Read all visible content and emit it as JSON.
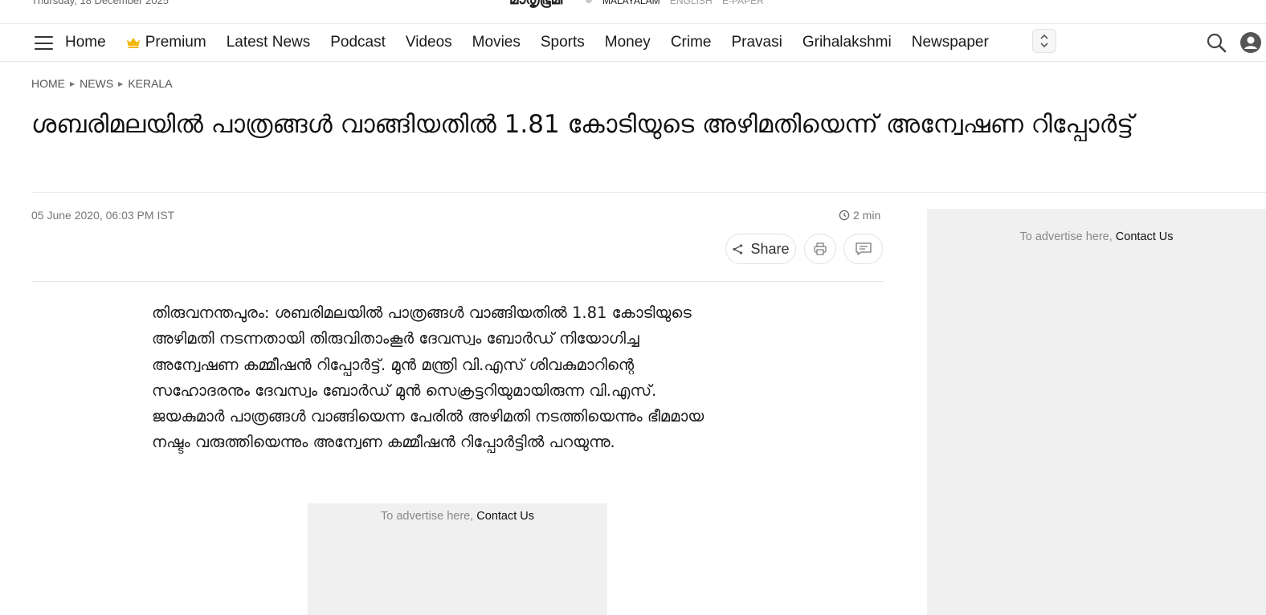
{
  "topbar": {
    "date": "Thursday, 18 December 2025",
    "logo": "മാതൃഭൂമി",
    "languages": [
      "MALAYALAM",
      "ENGLISH",
      "E-PAPER"
    ]
  },
  "nav": {
    "items": [
      "Home",
      "Premium",
      "Latest News",
      "Podcast",
      "Videos",
      "Movies",
      "Sports",
      "Money",
      "Crime",
      "Pravasi",
      "Grihalakshmi",
      "Newspaper"
    ],
    "premium_color": "#f2b600"
  },
  "breadcrumb": [
    "HOME",
    "NEWS",
    "KERALA"
  ],
  "article": {
    "headline": "ശബരിമലയിൽ പാത്രങ്ങൾ വാങ്ങിയതിൽ 1.81 കോടിയുടെ അഴിമതിയെന്ന് അന്വേഷണ റിപ്പോർട്ട്",
    "published": "05 June 2020, 06:03 PM IST",
    "read_time": "2 min",
    "share_label": "Share",
    "body": "തിരുവനന്തപുരം: ശബരിമലയിൽ പാത്രങ്ങൾ വാങ്ങിയതിൽ 1.81 കോടിയുടെ അഴിമതി നടന്നതായി തിരുവിതാംകൂർ ദേവസ്വം ബോർഡ് നിയോഗിച്ച അന്വേഷണ കമ്മീഷൻ റിപ്പോർട്ട്. മുൻ മന്ത്രി വി.എസ് ശിവകുമാറിന്റെ സഹോദരനും ദേവസ്വം ബോർഡ് മുൻ സെക്രട്ടറിയുമായിരുന്ന വി.എസ്. ജയകുമാർ പാത്രങ്ങൾ വാങ്ങിയെന്ന പേരിൽ അഴിമതി നടത്തിയെന്നും ഭീമമായ നഷ്ടം വരുത്തിയെന്നും അന്വേണ കമ്മീഷൻ റിപ്പോർട്ടിൽ പറയുന്നു."
  },
  "ads": {
    "prefix": "To advertise here, ",
    "contact": "Contact Us"
  }
}
